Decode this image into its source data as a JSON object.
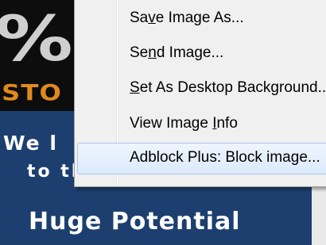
{
  "page": {
    "logo_glyph": "%",
    "logo_text": "STO",
    "banner_line1": "We l",
    "banner_line2": "to the Street!",
    "banner_line3": "Huge Potential"
  },
  "context_menu": {
    "items": [
      {
        "pre": "Sa",
        "mnemonic": "v",
        "post": "e Image As...",
        "highlighted": false
      },
      {
        "pre": "Se",
        "mnemonic": "n",
        "post": "d Image...",
        "highlighted": false
      },
      {
        "pre": "",
        "mnemonic": "S",
        "post": "et As Desktop Background...",
        "highlighted": false
      },
      {
        "pre": "View Image ",
        "mnemonic": "I",
        "post": "nfo",
        "highlighted": false
      },
      {
        "pre": "Adblock Plus: Block image...",
        "mnemonic": "",
        "post": "",
        "highlighted": true
      }
    ]
  },
  "colors": {
    "banner_blue": "#1c3f6f",
    "logo_orange": "#e08a1b",
    "menu_bg": "#f0f0f0",
    "highlight_border": "#a8c8ec"
  }
}
